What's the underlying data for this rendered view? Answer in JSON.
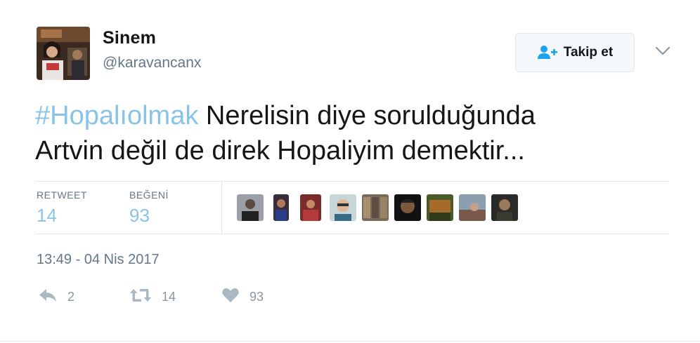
{
  "author": {
    "name": "Sinem",
    "handle": "@karavancanx",
    "avatar_icon": "profile-photo"
  },
  "follow": {
    "label": "Takip et",
    "icon": "add-user-icon"
  },
  "menu": {
    "icon": "chevron-down-icon"
  },
  "tweet": {
    "hashtag": "#Hopalıolmak",
    "text_line1": " Nerelisin diye sorulduğunda",
    "text_line2": "Artvin değil de direk Hopaliyim demektir..."
  },
  "stats": {
    "retweet_label": "RETWEET",
    "retweet_count": "14",
    "like_label": "BEĞENİ",
    "like_count": "93"
  },
  "liker_avatars": [
    "liker-avatar",
    "liker-avatar",
    "liker-avatar",
    "liker-avatar",
    "liker-avatar",
    "liker-avatar",
    "liker-avatar",
    "liker-avatar",
    "liker-avatar"
  ],
  "timestamp": "13:49 - 04 Nis 2017",
  "actions": {
    "reply": {
      "icon": "reply-icon",
      "count": "2"
    },
    "retweet": {
      "icon": "retweet-icon",
      "count": "14"
    },
    "like": {
      "icon": "heart-icon",
      "count": "93"
    }
  },
  "colors": {
    "hashtag": "#89c4e8",
    "stat_value": "#89c4e8",
    "muted_text": "#657786",
    "action_icon": "#aab8c2"
  }
}
